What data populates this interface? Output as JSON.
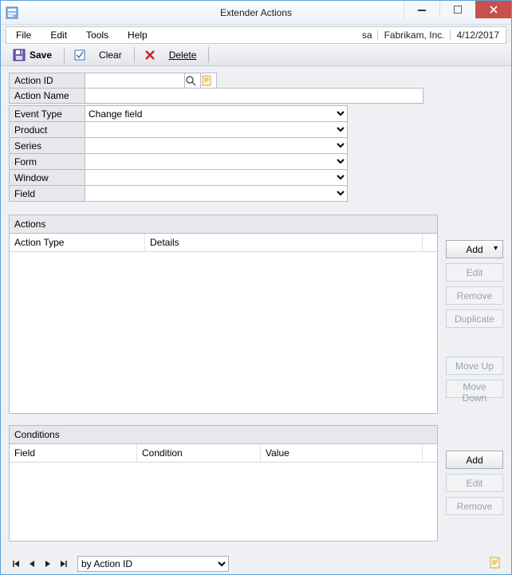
{
  "window": {
    "title": "Extender Actions"
  },
  "menus": {
    "file": "File",
    "edit": "Edit",
    "tools": "Tools",
    "help": "Help"
  },
  "status": {
    "user": "sa",
    "company": "Fabrikam, Inc.",
    "date": "4/12/2017"
  },
  "toolbar": {
    "save": "Save",
    "clear": "Clear",
    "delete": "Delete"
  },
  "form": {
    "labels": {
      "action_id": "Action ID",
      "action_name": "Action Name",
      "event_type": "Event Type",
      "product": "Product",
      "series": "Series",
      "form": "Form",
      "window": "Window",
      "field": "Field"
    },
    "values": {
      "action_id": "",
      "action_name": "",
      "event_type": "Change field",
      "product": "",
      "series": "",
      "form": "",
      "window": "",
      "field": ""
    }
  },
  "actions_panel": {
    "title": "Actions",
    "columns": {
      "action_type": "Action Type",
      "details": "Details"
    },
    "buttons": {
      "add": "Add",
      "edit": "Edit",
      "remove": "Remove",
      "duplicate": "Duplicate",
      "move_up": "Move Up",
      "move_down": "Move Down"
    }
  },
  "conditions_panel": {
    "title": "Conditions",
    "columns": {
      "field": "Field",
      "condition": "Condition",
      "value": "Value"
    },
    "buttons": {
      "add": "Add",
      "edit": "Edit",
      "remove": "Remove"
    }
  },
  "nav": {
    "sort": "by Action ID"
  }
}
